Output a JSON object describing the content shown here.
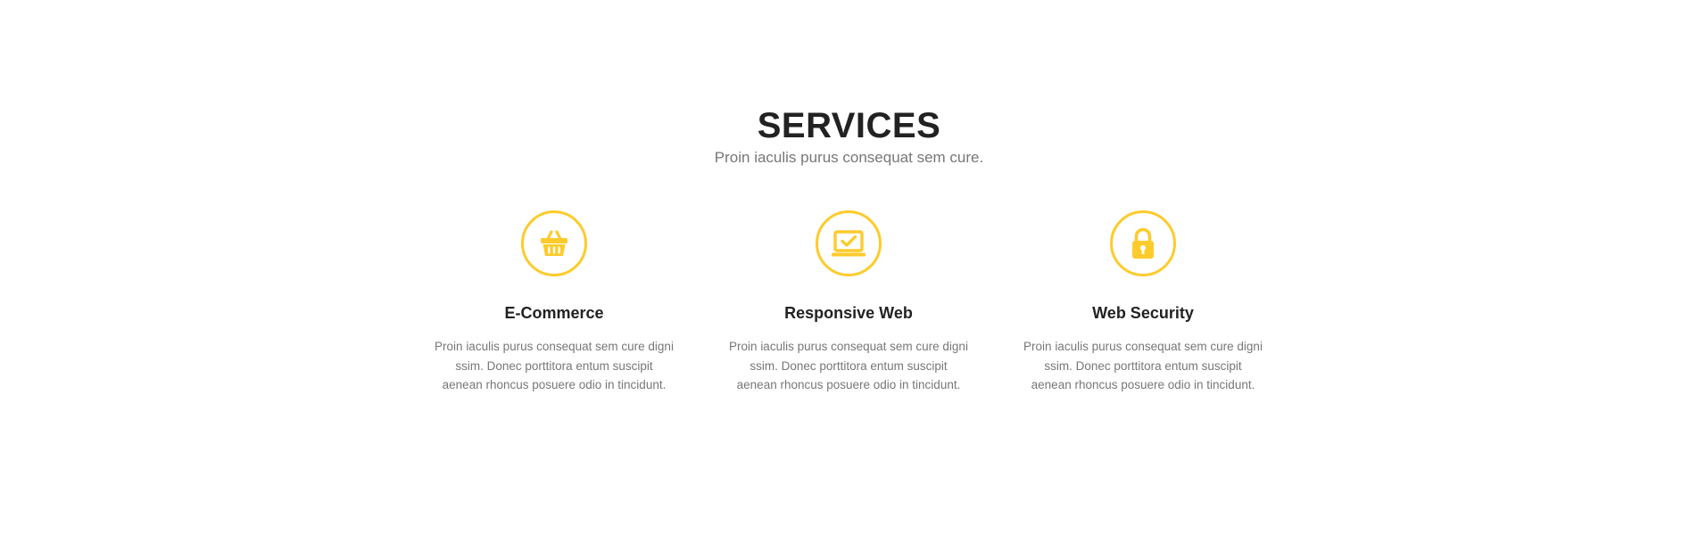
{
  "section": {
    "title": "SERVICES",
    "subtitle": "Proin iaculis purus consequat sem cure."
  },
  "accent_color": "#fdcb2b",
  "services": [
    {
      "icon": "basket-icon",
      "title": "E-Commerce",
      "text": "Proin iaculis purus consequat sem cure digni ssim. Donec porttitora entum suscipit aenean rhoncus posuere odio in tincidunt."
    },
    {
      "icon": "laptop-check-icon",
      "title": "Responsive Web",
      "text": "Proin iaculis purus consequat sem cure digni ssim. Donec porttitora entum suscipit aenean rhoncus posuere odio in tincidunt."
    },
    {
      "icon": "lock-icon",
      "title": "Web Security",
      "text": "Proin iaculis purus consequat sem cure digni ssim. Donec porttitora entum suscipit aenean rhoncus posuere odio in tincidunt."
    }
  ]
}
